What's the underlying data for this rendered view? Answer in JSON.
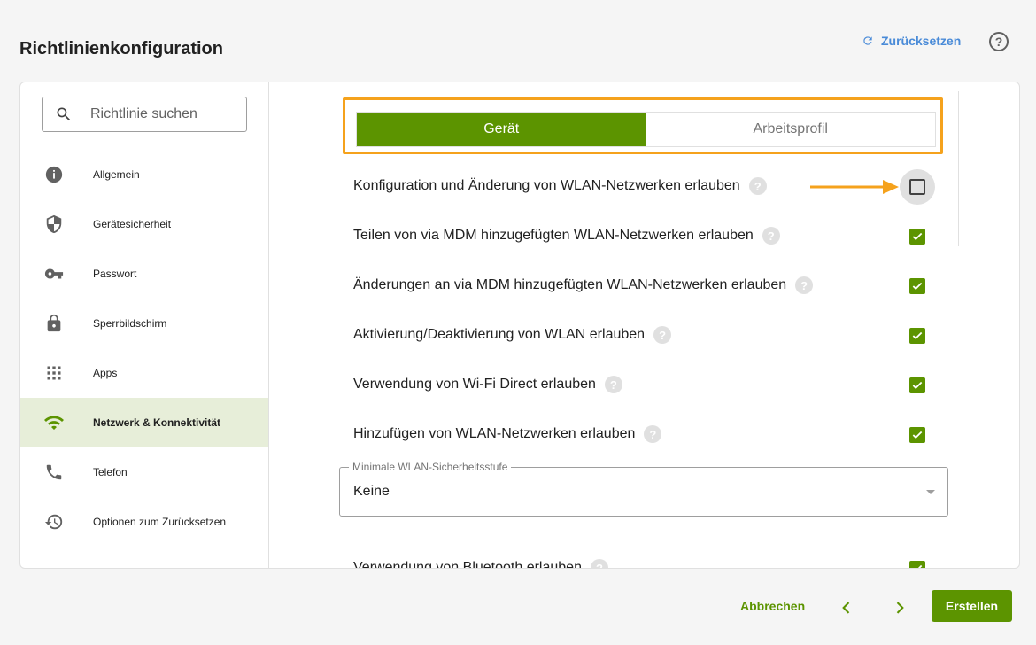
{
  "header": {
    "title": "Richtlinienkonfiguration",
    "reset_label": "Zurücksetzen",
    "help_label": "?"
  },
  "search": {
    "placeholder": "Richtlinie suchen"
  },
  "sidebar": {
    "items": [
      {
        "label": "Allgemein",
        "icon": "info-icon"
      },
      {
        "label": "Gerätesicherheit",
        "icon": "shield-icon"
      },
      {
        "label": "Passwort",
        "icon": "key-icon"
      },
      {
        "label": "Sperrbildschirm",
        "icon": "lock-icon"
      },
      {
        "label": "Apps",
        "icon": "grid-icon"
      },
      {
        "label": "Netzwerk & Konnektivität",
        "icon": "wifi-icon",
        "active": true
      },
      {
        "label": "Telefon",
        "icon": "phone-icon"
      },
      {
        "label": "Optionen zum Zurücksetzen",
        "icon": "history-icon"
      }
    ]
  },
  "tabs": [
    {
      "label": "Gerät",
      "active": true
    },
    {
      "label": "Arbeitsprofil",
      "active": false
    }
  ],
  "settings": [
    {
      "label": "Konfiguration und Änderung von WLAN-Netzwerken erlauben",
      "checked": false
    },
    {
      "label": "Teilen von via MDM hinzugefügten WLAN-Netzwerken erlauben",
      "checked": true
    },
    {
      "label": "Änderungen an via MDM hinzugefügten WLAN-Netzwerken erlauben",
      "checked": true
    },
    {
      "label": "Aktivierung/Deaktivierung von WLAN erlauben",
      "checked": true
    },
    {
      "label": "Verwendung von Wi-Fi Direct erlauben",
      "checked": true
    },
    {
      "label": "Hinzufügen von WLAN-Netzwerken erlauben",
      "checked": true
    },
    {
      "label": "Verwendung von Bluetooth erlauben",
      "checked": true
    }
  ],
  "security_select": {
    "label": "Minimale WLAN-Sicherheitsstufe",
    "value": "Keine"
  },
  "footer": {
    "cancel_label": "Abbrechen",
    "create_label": "Erstellen"
  },
  "colors": {
    "accent": "#5c9400",
    "highlight": "#f5a21c",
    "link": "#4a8bd8",
    "active_nav_bg": "#e7eed9"
  }
}
